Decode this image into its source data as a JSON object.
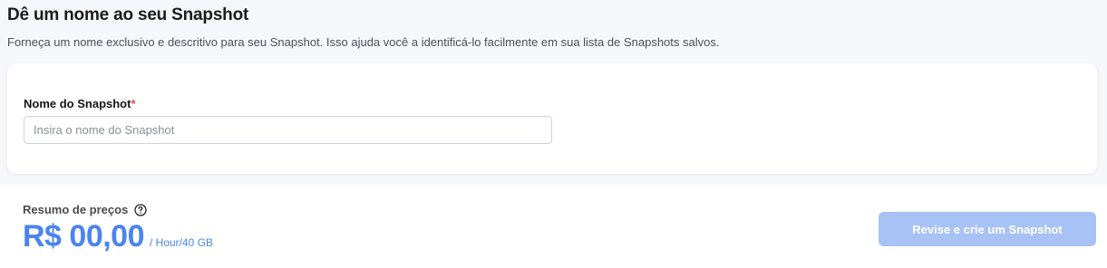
{
  "header": {
    "title": "Dê um nome ao seu Snapshot",
    "description": "Forneça um nome exclusivo e descritivo para seu Snapshot. Isso ajuda você a identificá-lo facilmente em sua lista de Snapshots salvos."
  },
  "form": {
    "name_label": "Nome do Snapshot",
    "required_marker": "*",
    "name_value": "",
    "name_placeholder": "Insira o nome do Snapshot"
  },
  "footer": {
    "price_summary_label": "Resumo de preços",
    "price_value": "R$ 00,00",
    "price_unit": "/ Hour/40 GB",
    "submit_label": "Revise e crie um Snapshot",
    "help_icon": "question-circle-icon"
  },
  "colors": {
    "accent": "#4b84ee",
    "button_disabled": "#a8c2f6",
    "required": "#e5484d",
    "page_bg": "#f6f7fb"
  }
}
